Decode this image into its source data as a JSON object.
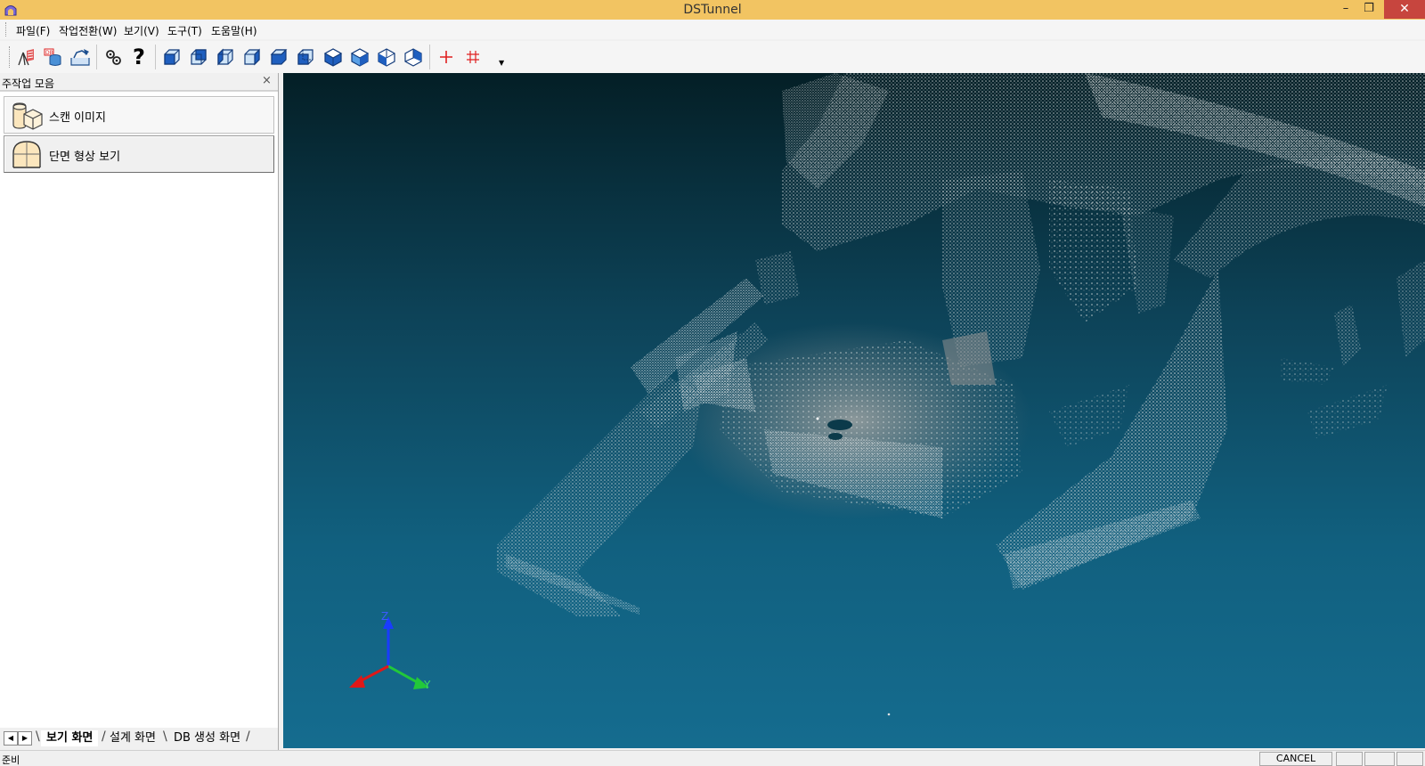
{
  "window": {
    "title": "DSTunnel",
    "minimize": "–",
    "maximize": "❐",
    "close": "✕"
  },
  "menu": {
    "items": [
      "파일(F)",
      "작업전환(W)",
      "보기(V)",
      "도구(T)",
      "도움말(H)"
    ]
  },
  "toolbar": {
    "buttons": [
      "survey-tool-icon",
      "database-icon",
      "export-icon",
      "settings-icon",
      "help-icon",
      "view-front-icon",
      "view-back-icon",
      "view-left-icon",
      "view-right-icon",
      "view-top-icon",
      "view-bottom-icon",
      "iso-view-1-icon",
      "iso-view-2-icon",
      "iso-view-3-icon",
      "iso-view-4-icon",
      "crosshair-icon",
      "multi-crosshair-icon"
    ],
    "help_glyph": "?"
  },
  "left_panel": {
    "title": "주작업 모음",
    "close": "×",
    "tasks": [
      {
        "label": "스캔 이미지",
        "icon": "scan-image-icon"
      },
      {
        "label": "단면 형상 보기",
        "icon": "tunnel-section-icon"
      }
    ]
  },
  "tabs": {
    "items": [
      "보기 화면",
      "설계 화면",
      "DB 생성 화면"
    ],
    "active": "보기 화면",
    "prev": "◀",
    "next": "▶"
  },
  "viewport": {
    "axes": {
      "z": "Z",
      "y": "Y",
      "x": "X"
    },
    "axis_colors": {
      "z": "#1a3cff",
      "y": "#22c83a",
      "x": "#e01818"
    },
    "background_top": "#041f26",
    "background_bottom": "#156c8f"
  },
  "status": {
    "text": "준비",
    "cancel": "CANCEL",
    "panes": [
      "",
      "",
      ""
    ]
  },
  "colors": {
    "titlebar": "#f2c462",
    "close_button": "#c7453e",
    "toolbar_cube": "#1f5fbf"
  }
}
